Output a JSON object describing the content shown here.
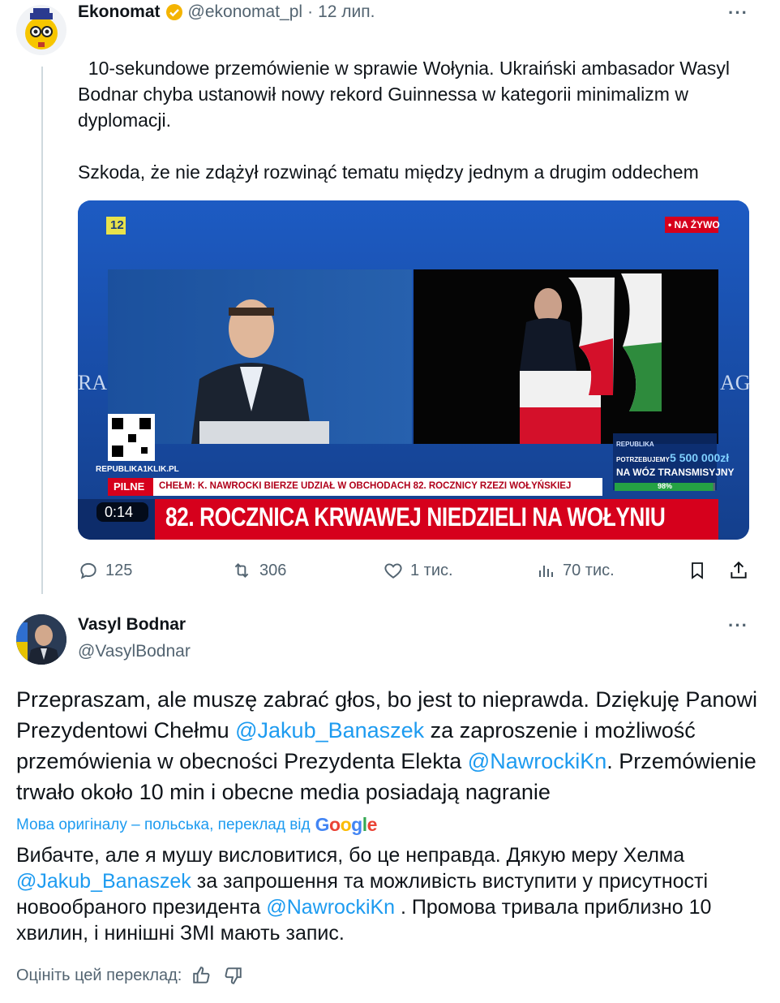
{
  "tweet1": {
    "author_name": "Ekonomat",
    "handle": "@ekonomat_pl",
    "separator": "·",
    "date": "12 лип.",
    "more": "···",
    "text": "10-sekundowe przemówienie w sprawie Wołynia. Ukraiński ambasador Wasyl Bodnar chyba ustanowił nowy rekord Guinnessa w kategorii minimalizm w dyplomacji.\n\nSzkoda, że nie zdążył rozwinąć tematu między jednym a drugim oddechem",
    "emoji": "👇",
    "video": {
      "channel_logo": "12",
      "live_badge": "• NA ŻYWO",
      "duration": "0:14",
      "site": "REPUBLIKA1KLIK.PL",
      "pilne": "PILNE",
      "ticker": "CHEŁM: K. NAWROCKI BIERZE UDZIAŁ W OBCHODACH 82. ROCZNICY RZEZI WOŁYŃSKIEJ",
      "headline": "82. ROCZNICA KRWAWEJ NIEDZIELI NA WOŁYNIU",
      "fund_brand": "REPUBLIKA",
      "fund_need": "POTRZEBUJEMY",
      "fund_amount": "5 500 000zł",
      "fund_target": "NA WÓZ TRANSMISYJNY",
      "fund_progress_label": "98%",
      "fund_progress": 0.98
    },
    "stats": {
      "replies": "125",
      "reposts": "306",
      "likes": "1 тис.",
      "views": "70 тис."
    }
  },
  "tweet2": {
    "author_name": "Vasyl Bodnar",
    "handle": "@VasylBodnar",
    "more": "···",
    "p1": "Przepraszam, ale muszę zabrać głos, bo jest to nieprawda. Dziękuję Panowi Prezydentowi Chełmu ",
    "m1": "@Jakub_Banaszek",
    "p2": " za zaproszenie i możliwość przemówienia w obecności Prezydenta Elekta ",
    "m2": "@NawrockiKn",
    "p3": ". Przemówienie trwało około 10 min i obecne media posiadają nagranie",
    "translation_note": "Мова оригіналу – польська, переклад від",
    "google": "Google",
    "tr1": "Вибачте, але я мушу висловитися, бо це неправда. Дякую меру Хелма ",
    "tm1": "@Jakub_Banaszek",
    "tr2": " за запрошення та можливість виступити у присутності новообраного президента ",
    "tm2": "@NawrockiKn",
    "tr3": " . Промова тривала приблизно 10 хвилин, і нинішні ЗМІ мають запис.",
    "rate_label": "Оцініть цей переклад:"
  },
  "colors": {
    "accent": "#1d9bf0",
    "muted": "#536471",
    "verified": "#f4b400",
    "headline_red": "#d6001c"
  }
}
